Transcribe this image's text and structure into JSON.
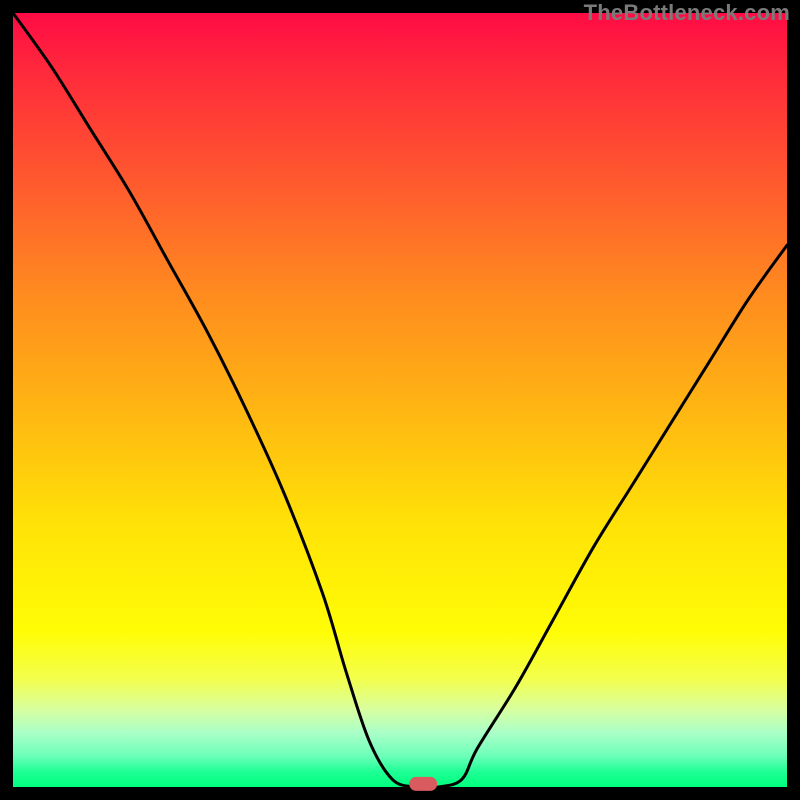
{
  "watermark": "TheBottleneck.com",
  "chart_data": {
    "type": "line",
    "title": "",
    "xlabel": "",
    "ylabel": "",
    "xlim": [
      0,
      100
    ],
    "ylim": [
      0,
      100
    ],
    "grid": false,
    "legend": false,
    "series": [
      {
        "name": "bottleneck-curve",
        "x": [
          0,
          5,
          10,
          15,
          20,
          25,
          30,
          35,
          40,
          43,
          46,
          49,
          52,
          55,
          58,
          60,
          65,
          70,
          75,
          80,
          85,
          90,
          95,
          100
        ],
        "y_pct": [
          100,
          93,
          85,
          77,
          68,
          59,
          49,
          38,
          25,
          15,
          6,
          1,
          0,
          0,
          1,
          5,
          13,
          22,
          31,
          39,
          47,
          55,
          63,
          70
        ]
      }
    ],
    "marker": {
      "name": "optimal-point",
      "x_pct": 53,
      "y_pct": 0.4,
      "color": "#d95a5f"
    },
    "background_gradient": {
      "top": "#ff0b44",
      "mid": "#ffe207",
      "bottom": "#00ff7f"
    }
  }
}
